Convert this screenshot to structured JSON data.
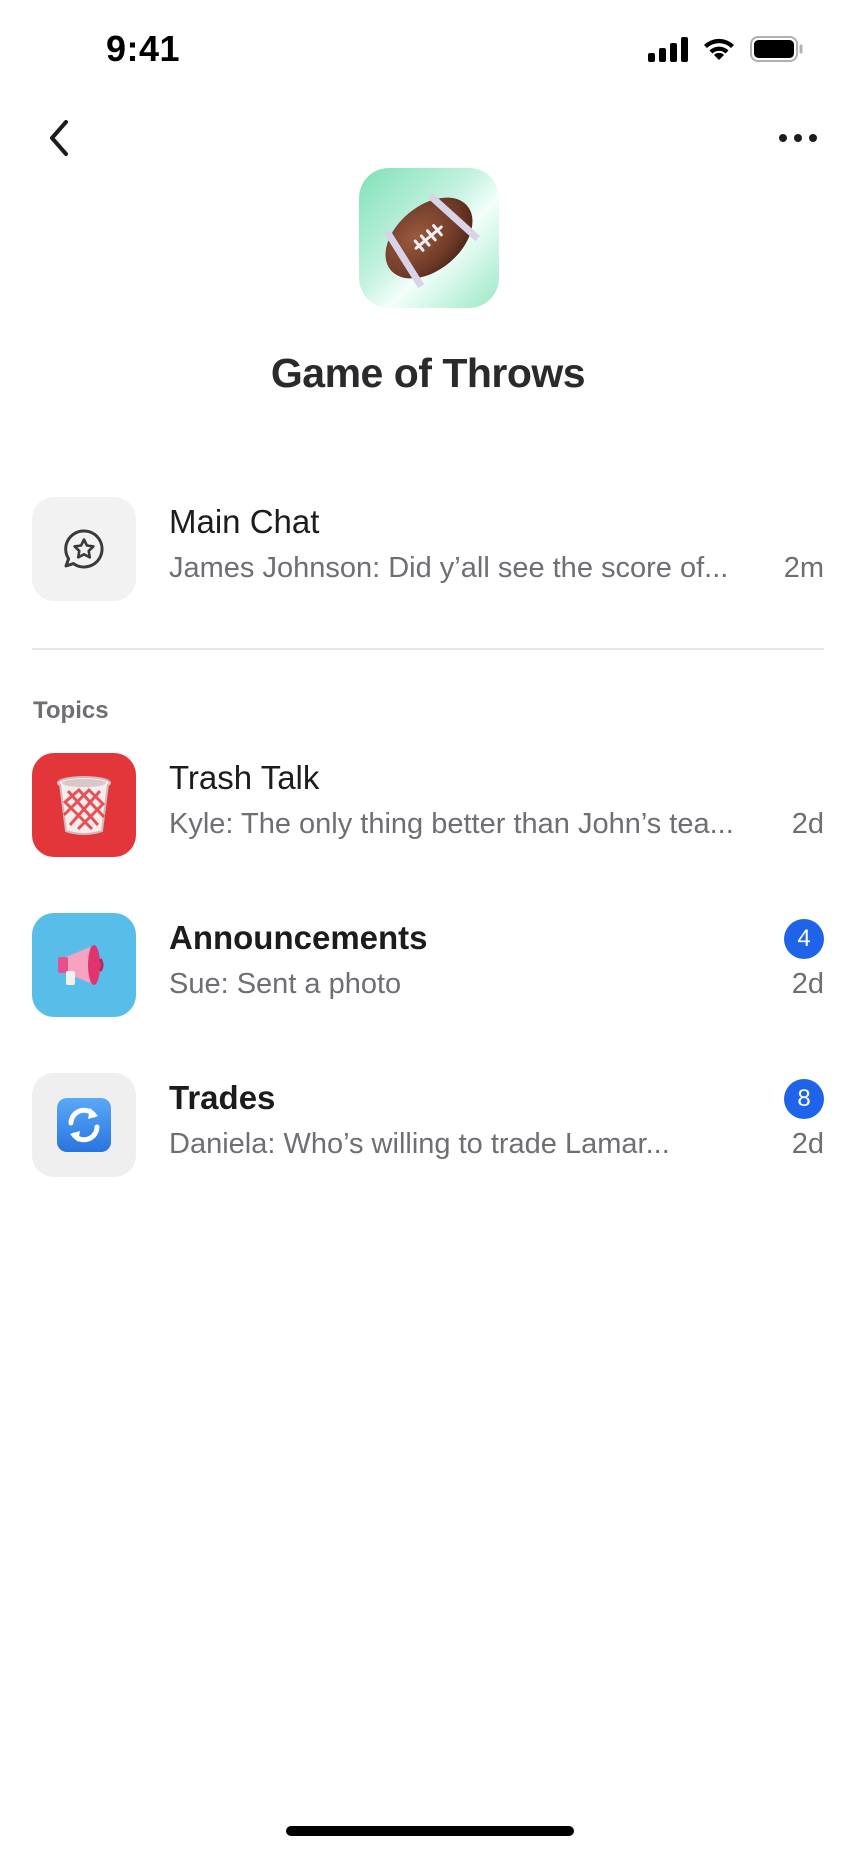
{
  "status_bar": {
    "time": "9:41"
  },
  "header": {
    "title": "Game of Throws",
    "avatar_icon": "american-football-icon"
  },
  "main_chat": {
    "title": "Main Chat",
    "preview": "James Johnson: Did y’all see the score of...",
    "time": "2m",
    "icon": "chat-star-icon"
  },
  "topics": {
    "label": "Topics",
    "items": [
      {
        "title": "Trash Talk",
        "preview": "Kyle: The only thing better than John’s tea...",
        "time": "2d",
        "badge": "",
        "icon": "wastebasket-icon",
        "icon_bg": "#e3363a"
      },
      {
        "title": "Announcements",
        "preview": "Sue: Sent a photo",
        "time": "2d",
        "badge": "4",
        "icon": "megaphone-icon",
        "icon_bg": "#59bdea"
      },
      {
        "title": "Trades",
        "preview": "Daniela: Who’s willing to trade Lamar...",
        "time": "2d",
        "badge": "8",
        "icon": "arrows-cycle-icon",
        "icon_bg": "#efeff0"
      }
    ]
  },
  "colors": {
    "accent": "#1e63ea",
    "secondary_text": "#6e6e73"
  }
}
